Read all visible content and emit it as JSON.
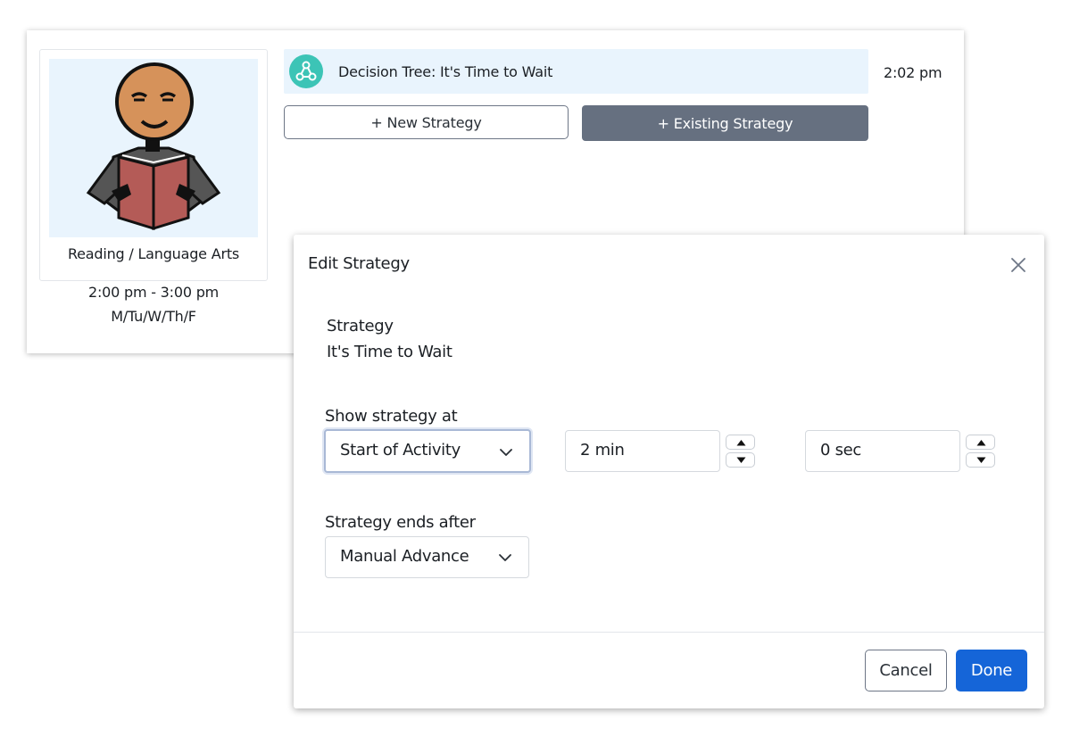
{
  "activity": {
    "label": "Reading / Language Arts",
    "time": "2:00 pm - 3:00 pm",
    "days": "M/Tu/W/Th/F",
    "image_icon": "reading-person-icon"
  },
  "strategy_row": {
    "icon": "decision-tree-icon",
    "title": "Decision Tree: It's Time to Wait",
    "time": "2:02 pm"
  },
  "buttons": {
    "new_strategy": "+ New Strategy",
    "existing_strategy": "+ Existing Strategy"
  },
  "modal": {
    "title": "Edit Strategy",
    "strategy_label": "Strategy",
    "strategy_value": "It's Time to Wait",
    "show_at_label": "Show strategy at",
    "show_at_select": "Start of Activity",
    "minutes_value": "2 min",
    "seconds_value": "0 sec",
    "ends_after_label": "Strategy ends after",
    "ends_after_select": "Manual Advance",
    "cancel_label": "Cancel",
    "done_label": "Done"
  },
  "colors": {
    "accent": "#1565d8",
    "secondary_button": "#667080",
    "highlight_bg": "#e9f4fd",
    "tree_icon_bg": "#3cc4b6"
  }
}
